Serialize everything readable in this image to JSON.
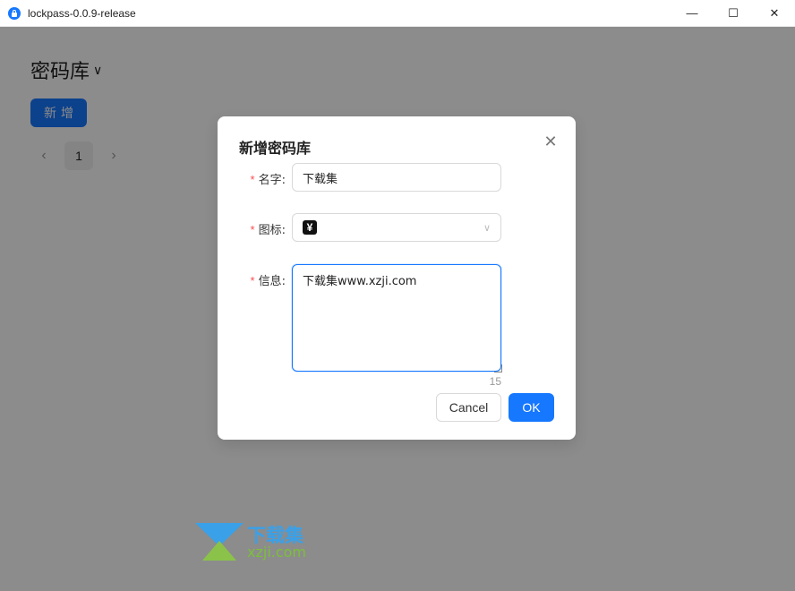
{
  "window": {
    "title": "lockpass-0.0.9-release",
    "minimize": "—",
    "maximize": "☐",
    "close": "✕"
  },
  "vault": {
    "title": "密码库",
    "dropdown_icon": "chevron-down-icon",
    "new_button": "新增"
  },
  "pagination": {
    "prev": "‹",
    "current_page": "1",
    "next": "›"
  },
  "modal": {
    "title": "新增密码库",
    "close_icon": "close-icon",
    "fields": {
      "name": {
        "required_mark": "*",
        "label": "名字:",
        "value": "下载集"
      },
      "icon": {
        "required_mark": "*",
        "label": "图标:",
        "selected_icon": "yuan-icon",
        "selected_glyph": "¥"
      },
      "info": {
        "required_mark": "*",
        "label": "信息:",
        "value": "下载集www.xzji.com",
        "char_count": "15"
      }
    },
    "cancel_label": "Cancel",
    "ok_label": "OK"
  },
  "watermark": {
    "cn_text": "下载集",
    "en_text": "xzji.com"
  },
  "colors": {
    "primary": "#1677ff",
    "required": "#ff4d4f",
    "mask": "rgba(0,0,0,0.45)"
  }
}
